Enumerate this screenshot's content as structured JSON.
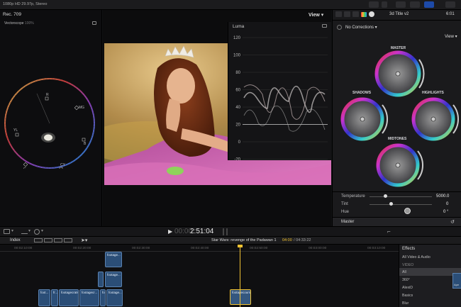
{
  "topbar": {
    "format_meta": "1080p HD 29.97p, Stereo",
    "rec_label": "Rec. 709"
  },
  "vectorscope": {
    "label": "Vectorscope",
    "percent": "100%",
    "targets": [
      "R",
      "MG",
      "B",
      "CY",
      "G",
      "YL"
    ]
  },
  "viewer": {
    "view_label": "View",
    "luma_label": "Luma",
    "luma_ticks": [
      "120",
      "100",
      "80",
      "60",
      "40",
      "20",
      "0",
      "-20"
    ]
  },
  "inspector": {
    "title": "3d Title v2",
    "timecode": "6:01",
    "corrections": "No Corrections",
    "view_label": "View",
    "wheels": [
      "MASTER",
      "SHADOWS",
      "HIGHLIGHTS",
      "MIDTONES"
    ],
    "params": [
      {
        "label": "Temperature",
        "value": "5000.0"
      },
      {
        "label": "Tint",
        "value": "0"
      },
      {
        "label": "Hue",
        "value": "0 °"
      }
    ],
    "footer": "Master"
  },
  "transport": {
    "timecode": "2:51:04",
    "timecode_dim": "00:00"
  },
  "timeline_head": {
    "index": "Index",
    "project": "Star Wars: revenge of the Padawan 1",
    "time_current": "04:00",
    "time_total": "04:33:22"
  },
  "timeline": {
    "ticks": [
      "00:02:10:00",
      "00:02:20:00",
      "00:02:30:00",
      "00:02:40:00",
      "00:02:50:00",
      "00:03:00:00",
      "00:03:10:00"
    ],
    "clips_top": [
      {
        "label": "footage..."
      },
      {
        "label": "footage..."
      }
    ],
    "clips_main": [
      {
        "label": "foot..."
      },
      {
        "label": "footagecrats..."
      },
      {
        "label": "footagecr..."
      },
      {
        "label": "foo..."
      },
      {
        "label": "footage..."
      },
      {
        "label": "fr..."
      }
    ],
    "selected_clip": "footagecourses"
  },
  "effects": {
    "header": "Effects",
    "items": [
      "All Video & Audio",
      "VIDEO",
      "All",
      "360°",
      "AlexiD",
      "Basics",
      "Blur"
    ],
    "thumb_label": "Ape"
  },
  "colors": {
    "accent_yellow": "#f1c232",
    "clip_blue": "#2b4e77",
    "active_blue": "#1d4aa8"
  }
}
